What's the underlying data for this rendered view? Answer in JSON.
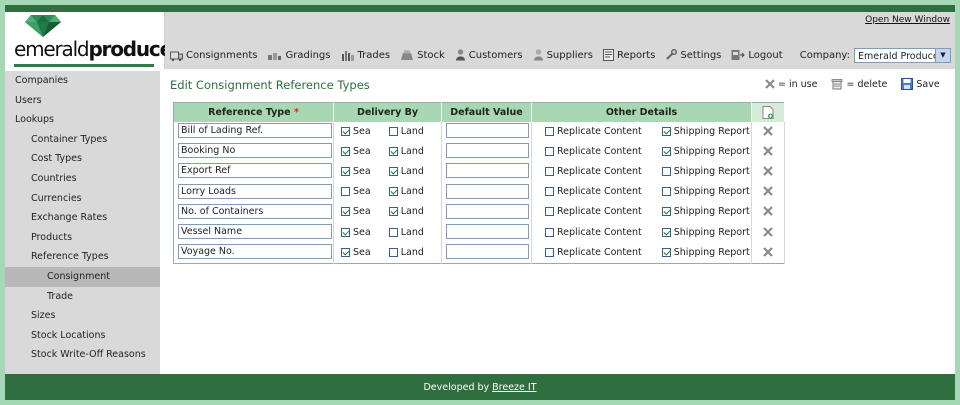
{
  "header": {
    "logo_regular": "emerald",
    "logo_bold": "produce",
    "open_new_window": "Open New Window",
    "company_label": "Company:",
    "company_value": "Emerald Produce"
  },
  "nav": [
    {
      "label": "Consignments",
      "icon": "consignments-icon"
    },
    {
      "label": "Gradings",
      "icon": "gradings-icon"
    },
    {
      "label": "Trades",
      "icon": "trades-icon"
    },
    {
      "label": "Stock",
      "icon": "stock-icon"
    },
    {
      "label": "Customers",
      "icon": "customers-icon"
    },
    {
      "label": "Suppliers",
      "icon": "suppliers-icon"
    },
    {
      "label": "Reports",
      "icon": "reports-icon"
    },
    {
      "label": "Settings",
      "icon": "settings-icon"
    },
    {
      "label": "Logout",
      "icon": "logout-icon"
    }
  ],
  "sidebar": [
    {
      "label": "Companies",
      "level": 0
    },
    {
      "label": "Users",
      "level": 0
    },
    {
      "label": "Lookups",
      "level": 0
    },
    {
      "label": "Container Types",
      "level": 1
    },
    {
      "label": "Cost Types",
      "level": 1
    },
    {
      "label": "Countries",
      "level": 1
    },
    {
      "label": "Currencies",
      "level": 1
    },
    {
      "label": "Exchange Rates",
      "level": 1
    },
    {
      "label": "Products",
      "level": 1
    },
    {
      "label": "Reference Types",
      "level": 1
    },
    {
      "label": "Consignment",
      "level": 2,
      "active": true
    },
    {
      "label": "Trade",
      "level": 2
    },
    {
      "label": "Sizes",
      "level": 1
    },
    {
      "label": "Stock Locations",
      "level": 1
    },
    {
      "label": "Stock Write-Off Reasons",
      "level": 1
    }
  ],
  "page": {
    "title": "Edit Consignment Reference Types",
    "legend_in_use": "= in use",
    "legend_delete": "= delete",
    "save_label": "Save"
  },
  "table": {
    "headers": {
      "reference_type": "Reference Type",
      "required_mark": "*",
      "delivery_by": "Delivery By",
      "default_value": "Default Value",
      "other_details": "Other Details"
    },
    "labels": {
      "sea": "Sea",
      "land": "Land",
      "replicate": "Replicate Content",
      "shipping": "Shipping Report"
    },
    "rows": [
      {
        "name": "Bill of Lading Ref.",
        "sea": true,
        "land": false,
        "default": "",
        "replicate": false,
        "shipping": true
      },
      {
        "name": "Booking No",
        "sea": true,
        "land": true,
        "default": "",
        "replicate": false,
        "shipping": true
      },
      {
        "name": "Export Ref",
        "sea": true,
        "land": true,
        "default": "",
        "replicate": false,
        "shipping": false
      },
      {
        "name": "Lorry Loads",
        "sea": false,
        "land": true,
        "default": "",
        "replicate": false,
        "shipping": false
      },
      {
        "name": "No. of Containers",
        "sea": true,
        "land": true,
        "default": "",
        "replicate": false,
        "shipping": true
      },
      {
        "name": "Vessel Name",
        "sea": true,
        "land": false,
        "default": "",
        "replicate": false,
        "shipping": true
      },
      {
        "name": "Voyage No.",
        "sea": true,
        "land": false,
        "default": "",
        "replicate": false,
        "shipping": true
      }
    ]
  },
  "footer": {
    "developed_by": "Developed by",
    "company_link": "Breeze IT"
  },
  "colors": {
    "brand_green": "#2e6e3f",
    "header_green": "#a8d8b2",
    "background": "#a6d8b8"
  }
}
